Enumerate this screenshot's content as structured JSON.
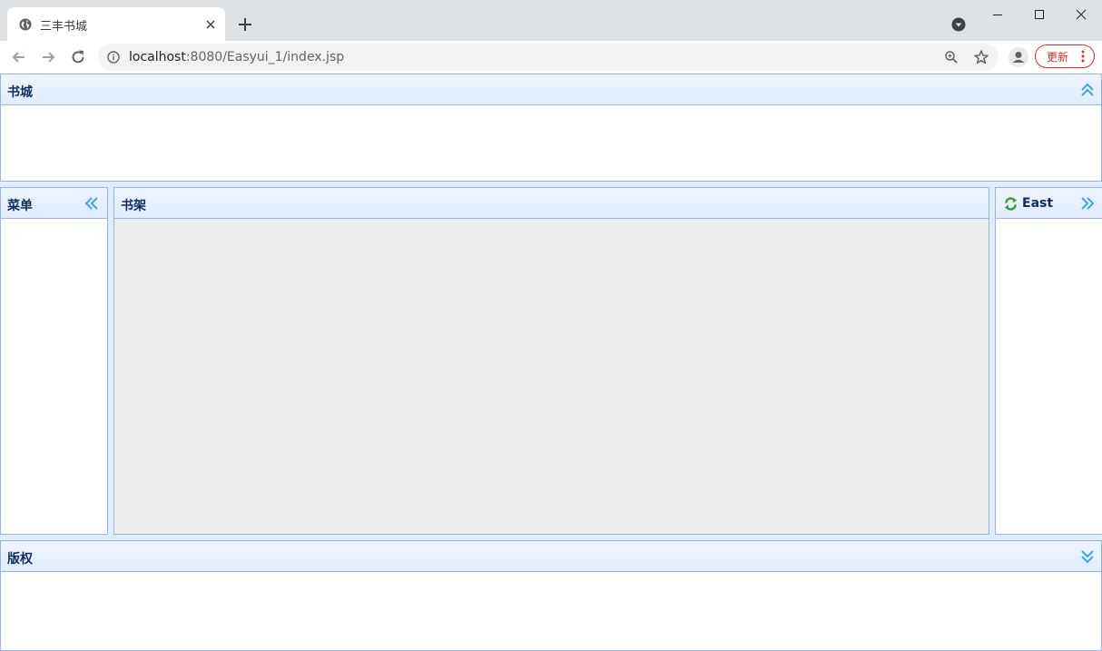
{
  "browser": {
    "tab_title": "三丰书城",
    "url_host": "localhost",
    "url_path": ":8080/Easyui_1/index.jsp",
    "update_label": "更新"
  },
  "layout": {
    "north": {
      "title": "书城",
      "tool_icon": "double-chevron-up-icon"
    },
    "west": {
      "title": "菜单",
      "tool_icon": "double-chevron-left-icon"
    },
    "center": {
      "title": "书架"
    },
    "east": {
      "title": "East",
      "title_icon": "reload-icon",
      "tool_icon": "double-chevron-right-icon"
    },
    "south": {
      "title": "版权",
      "tool_icon": "double-chevron-down-icon"
    }
  },
  "colors": {
    "header_text": "#0e2d5f",
    "panel_border": "#95b8e7",
    "center_body": "#ececec",
    "collapse_icon": "#3aa8e0",
    "update_accent": "#d93025"
  }
}
